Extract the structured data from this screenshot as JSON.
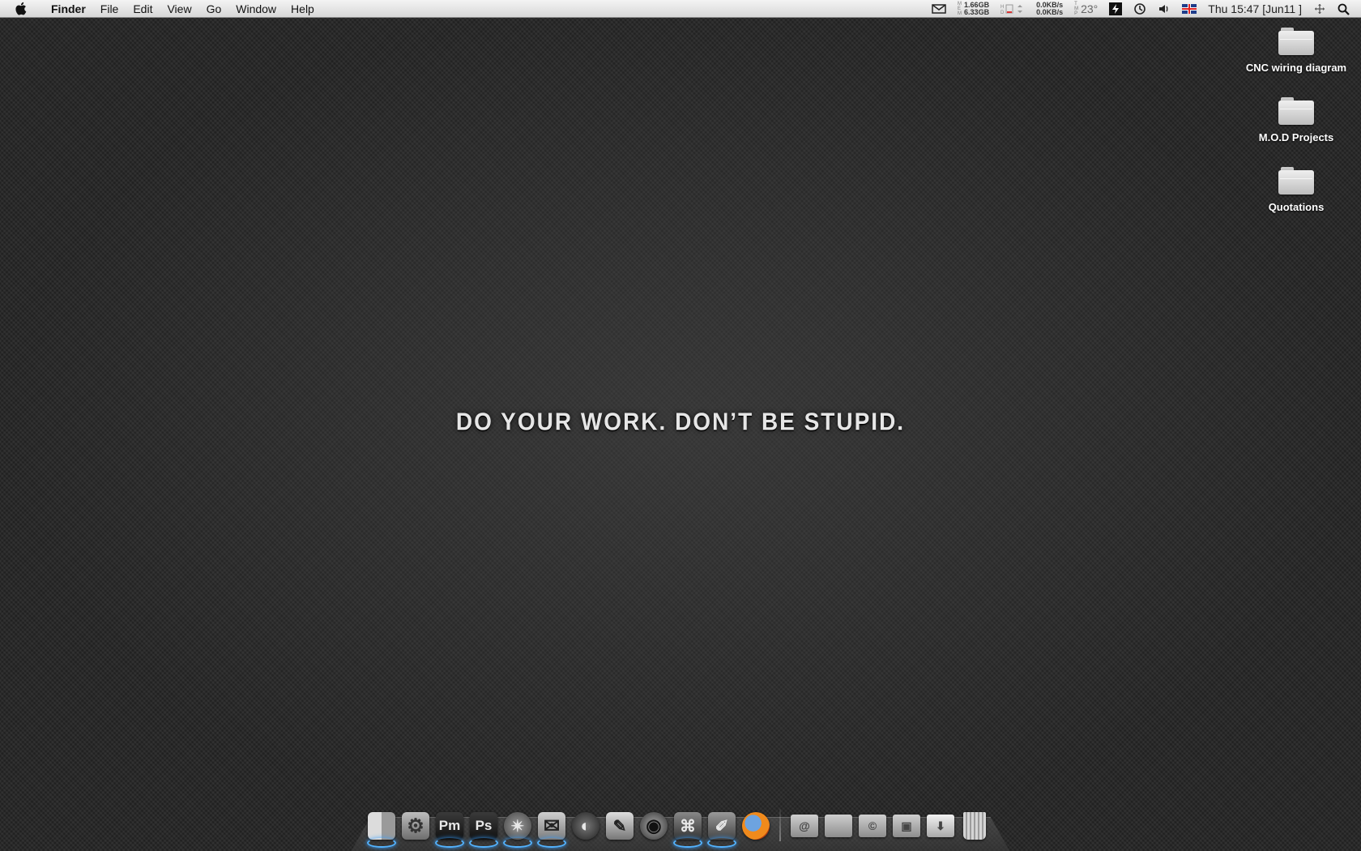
{
  "menubar": {
    "apple_icon": "apple-icon",
    "app_name": "Finder",
    "menus": [
      "File",
      "Edit",
      "View",
      "Go",
      "Window",
      "Help"
    ],
    "status": {
      "memory_top": "1.66GB",
      "memory_bottom": "6.33GB",
      "net_down": "0.0KB/s",
      "net_up": "0.0KB/s",
      "temperature": "23°",
      "clock": "Thu 15:47 [Jun11 ]"
    }
  },
  "desktop": {
    "motto": "DO YOUR WORK. DON’T BE STUPID.",
    "icons": [
      {
        "label": "CNC wiring diagram",
        "icon": "folder-icon"
      },
      {
        "label": "M.O.D Projects",
        "icon": "folder-icon"
      },
      {
        "label": "Quotations",
        "icon": "folder-icon"
      }
    ]
  },
  "dock": {
    "apps": [
      {
        "name": "finder-icon",
        "glyph": "",
        "running": true
      },
      {
        "name": "system-preferences-icon",
        "glyph": "⚙",
        "running": false
      },
      {
        "name": "pagemaker-icon",
        "glyph": "Pm",
        "running": true
      },
      {
        "name": "photoshop-icon",
        "glyph": "Ps",
        "running": true
      },
      {
        "name": "safari-icon",
        "glyph": "✴",
        "running": true
      },
      {
        "name": "mail-icon",
        "glyph": "✉",
        "running": true
      },
      {
        "name": "disc-icon",
        "glyph": "◐",
        "running": false
      },
      {
        "name": "script-editor-icon",
        "glyph": "✎",
        "running": false
      },
      {
        "name": "quicktime-icon",
        "glyph": "◉",
        "running": false
      },
      {
        "name": "app-icon",
        "glyph": "⌘",
        "running": true
      },
      {
        "name": "brush-icon",
        "glyph": "✐",
        "running": true
      },
      {
        "name": "firefox-icon",
        "glyph": "●",
        "running": false
      }
    ],
    "folders": [
      {
        "name": "mail-folder-icon",
        "glyph": "@"
      },
      {
        "name": "applications-folder-icon",
        "glyph": ""
      },
      {
        "name": "documents-folder-icon",
        "glyph": "©"
      },
      {
        "name": "movies-folder-icon",
        "glyph": "▣"
      },
      {
        "name": "downloads-folder-icon",
        "glyph": "⬇"
      }
    ],
    "trash_icon": "trash-icon"
  }
}
